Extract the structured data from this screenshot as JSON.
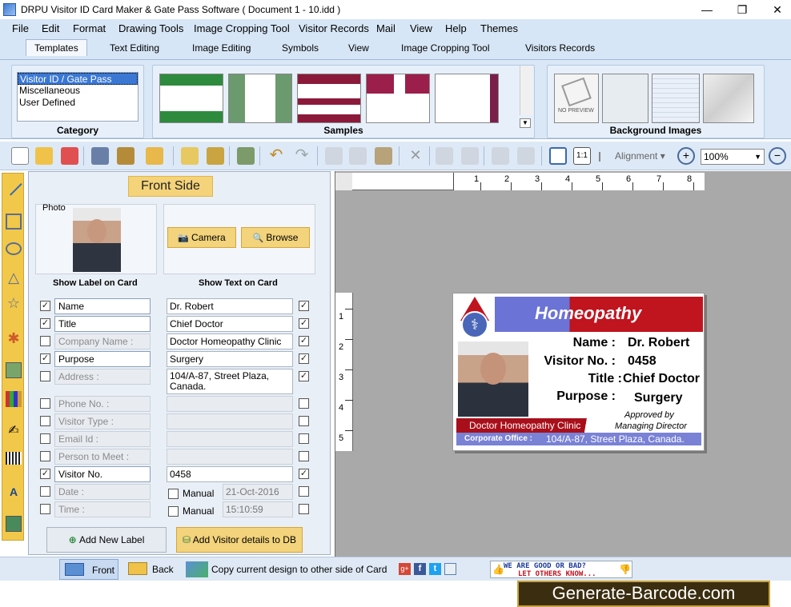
{
  "window": {
    "title": "DRPU Visitor ID Card Maker & Gate Pass Software ( Document 1 - 10.idd )",
    "minimize": "—",
    "restore": "❐",
    "close": "✕"
  },
  "menu": [
    "File",
    "Edit",
    "Format",
    "Drawing Tools",
    "Image Cropping Tool",
    "Visitor Records",
    "Mail",
    "View",
    "Help",
    "Themes"
  ],
  "ribbon_tabs": [
    "Templates",
    "Text Editing",
    "Image Editing",
    "Symbols",
    "View",
    "Image Cropping Tool",
    "Visitors Records"
  ],
  "ribbon": {
    "category_label": "Category",
    "categories": [
      "Visitor ID / Gate Pass",
      "Miscellaneous",
      "User Defined"
    ],
    "samples_label": "Samples",
    "background_label": "Background Images",
    "no_preview": "NO PREVIEW"
  },
  "toolbar": {
    "alignment": "Alignment",
    "zoom": "100%"
  },
  "panel": {
    "header": "Front Side",
    "photo_label": "Photo",
    "camera": "Camera",
    "browse": "Browse",
    "show_label": "Show Label on Card",
    "show_text": "Show Text on Card",
    "fields": [
      {
        "label": "Name",
        "value": "Dr. Robert",
        "label_on": true,
        "text_on": true
      },
      {
        "label": "Title",
        "value": "Chief Doctor",
        "label_on": true,
        "text_on": true
      },
      {
        "label": "Company Name :",
        "value": "Doctor Homeopathy Clinic",
        "label_on": false,
        "text_on": true
      },
      {
        "label": "Purpose",
        "value": "Surgery",
        "label_on": true,
        "text_on": true
      },
      {
        "label": "Address :",
        "value": "104/A-87, Street Plaza,\nCanada.",
        "label_on": false,
        "text_on": true
      },
      {
        "label": "Phone No. :",
        "value": "",
        "label_on": false,
        "text_on": false
      },
      {
        "label": "Visitor Type :",
        "value": "",
        "label_on": false,
        "text_on": false
      },
      {
        "label": "Email Id :",
        "value": "",
        "label_on": false,
        "text_on": false
      },
      {
        "label": "Person to Meet :",
        "value": "",
        "label_on": false,
        "text_on": false
      },
      {
        "label": "Visitor No.",
        "value": "0458",
        "label_on": true,
        "text_on": true
      },
      {
        "label": "Date :",
        "value": "21-Oct-2016",
        "label_on": false,
        "text_on": false
      },
      {
        "label": "Time :",
        "value": "15:10:59",
        "label_on": false,
        "text_on": false
      }
    ],
    "manual": "Manual",
    "add_label": "Add New Label",
    "add_visitor": "Add Visitor details to DB"
  },
  "ruler": {
    "h": [
      "1",
      "2",
      "3",
      "4",
      "5",
      "6",
      "7",
      "8"
    ],
    "v": [
      "1",
      "2",
      "3",
      "4",
      "5"
    ]
  },
  "card": {
    "banner": "Homeopathy",
    "name_label": "Name :",
    "name": "Dr. Robert",
    "visitor_label": "Visitor No. :",
    "visitor": "0458",
    "title_label": "Title :",
    "title": "Chief Doctor",
    "purpose_label": "Purpose :",
    "purpose": "Surgery",
    "approved": "Approved by",
    "md": "Managing Director",
    "company": "Doctor Homeopathy Clinic",
    "office_label": "Corporate Office :",
    "address": "104/A-87, Street Plaza, Canada."
  },
  "status": {
    "front": "Front",
    "back": "Back",
    "copy": "Copy current design to other side of Card",
    "feedback1": "WE ARE GOOD OR BAD?",
    "feedback2": "LET OTHERS KNOW..."
  },
  "watermark": "Generate-Barcode.com",
  "colors": {
    "accent": "#c0141e",
    "banner_blue": "#6b73d6",
    "ribbon": "#d9e7f6",
    "yellow": "#f3d37b"
  }
}
